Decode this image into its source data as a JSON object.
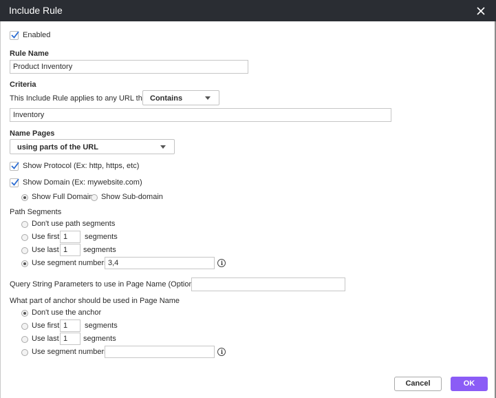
{
  "dialog": {
    "title": "Include Rule"
  },
  "enabled": {
    "label": "Enabled",
    "checked": true
  },
  "rule_name": {
    "label": "Rule Name",
    "value": "Product Inventory"
  },
  "criteria": {
    "label": "Criteria",
    "prefix": "This Include Rule applies to any URL that",
    "operator": "Contains",
    "value": "Inventory"
  },
  "name_pages": {
    "label": "Name Pages",
    "method": "using parts of the URL"
  },
  "show_protocol": {
    "label": "Show Protocol (Ex: http, https, etc)",
    "checked": true
  },
  "show_domain": {
    "label": "Show Domain (Ex: mywebsite.com)",
    "checked": true
  },
  "domain_options": {
    "full": "Show Full Domain",
    "sub": "Show Sub-domain",
    "selected": "full"
  },
  "path_segments": {
    "label": "Path Segments",
    "dont_use": "Don't use path segments",
    "use_first": "Use first",
    "use_first_value": "1",
    "use_last": "Use last",
    "use_last_value": "1",
    "segments_word": "segments",
    "use_numbers": "Use segment numbers",
    "use_numbers_value": "3,4",
    "selected": "use_numbers"
  },
  "query_string": {
    "label": "Query String Parameters to use in Page Name (Optional)",
    "value": ""
  },
  "anchor": {
    "label": "What part of anchor should be used in Page Name",
    "dont_use": "Don't use the anchor",
    "use_first": "Use first",
    "use_first_value": "1",
    "use_last": "Use last",
    "use_last_value": "1",
    "segments_word": "segments",
    "use_numbers": "Use segment numbers",
    "use_numbers_value": "",
    "selected": "dont_use"
  },
  "buttons": {
    "cancel": "Cancel",
    "ok": "OK"
  },
  "colors": {
    "titlebar": "#2a2d33",
    "accent": "#8b5cf6",
    "check": "#2a6bd1"
  }
}
